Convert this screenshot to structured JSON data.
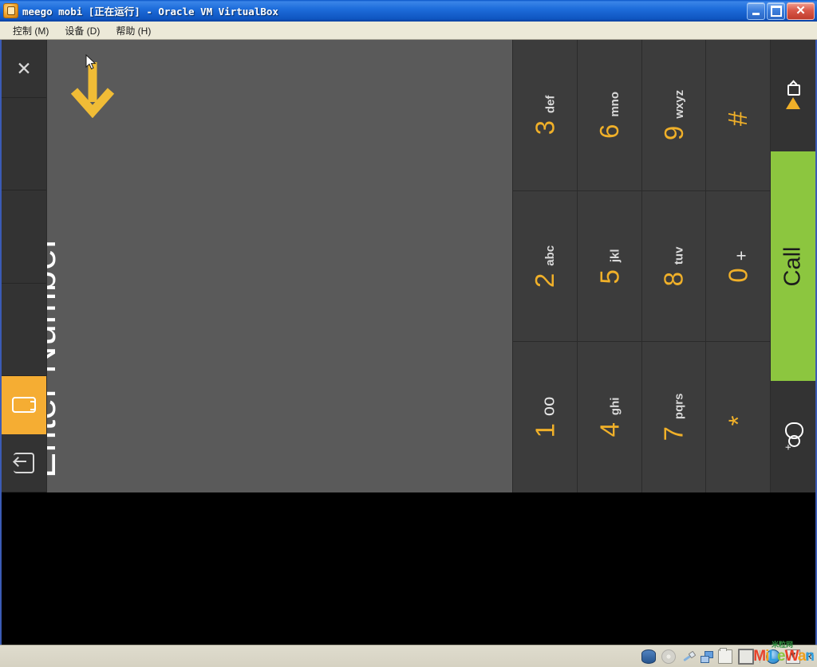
{
  "window": {
    "title": "meego mobi [正在运行] - Oracle VM VirtualBox",
    "app_icon": "virtualbox-icon",
    "buttons": {
      "minimize": "minimize-icon",
      "maximize": "maximize-icon",
      "close": "close-icon"
    }
  },
  "menubar": {
    "items": [
      {
        "label": "控制 (M)",
        "name": "menu-control"
      },
      {
        "label": "设备 (D)",
        "name": "menu-devices"
      },
      {
        "label": "帮助 (H)",
        "name": "menu-help"
      }
    ]
  },
  "guest": {
    "app_bar": {
      "close_glyph": "✕",
      "items": [
        {
          "name": "appbar-close",
          "icon": "close-icon"
        },
        {
          "name": "appbar-slot-1",
          "icon": ""
        },
        {
          "name": "appbar-slot-2",
          "icon": ""
        },
        {
          "name": "appbar-slot-3",
          "icon": ""
        },
        {
          "name": "appbar-dialer",
          "icon": "dialer-icon",
          "active": true
        },
        {
          "name": "appbar-back",
          "icon": "back-icon"
        }
      ]
    },
    "number_entry": {
      "placeholder": "Enter Number",
      "value": "",
      "hint_arrow": "down-arrow-icon"
    },
    "keypad": {
      "columns": [
        {
          "keys": [
            {
              "digit": "3",
              "letters": "def"
            },
            {
              "digit": "2",
              "letters": "abc"
            },
            {
              "digit": "1",
              "letters": "oo"
            }
          ]
        },
        {
          "keys": [
            {
              "digit": "6",
              "letters": "mno"
            },
            {
              "digit": "5",
              "letters": "jkl"
            },
            {
              "digit": "4",
              "letters": "ghi"
            }
          ]
        },
        {
          "keys": [
            {
              "digit": "9",
              "letters": "wxyz"
            },
            {
              "digit": "8",
              "letters": "tuv"
            },
            {
              "digit": "7",
              "letters": "pqrs"
            }
          ]
        },
        {
          "keys": [
            {
              "digit": "#",
              "letters": ""
            },
            {
              "digit": "0",
              "letters": "+"
            },
            {
              "digit": "*",
              "letters": ""
            }
          ]
        }
      ]
    },
    "actions": {
      "video_call": {
        "label": "",
        "icon": "video-call-icon"
      },
      "call": {
        "label": "Call",
        "color": "#8cc63f"
      },
      "add_contact": {
        "label": "",
        "icon": "add-contact-icon"
      }
    }
  },
  "statusbar": {
    "icons": [
      "hard-disk-icon",
      "cd-icon",
      "usb-icon",
      "network-icon",
      "shared-folder-icon",
      "display-icon",
      "globe-icon",
      "host-key-icon"
    ],
    "host_key_text": "Ri",
    "watermark": {
      "top_text": "米粒网",
      "letters": [
        "M",
        "i",
        "L",
        "e",
        "W",
        "a",
        "n"
      ]
    }
  },
  "colors": {
    "accent_orange": "#f0b029",
    "call_green": "#8cc63f",
    "appbar_active": "#f5ad33",
    "guest_bg": "#5a5a5a",
    "keypad_bg": "#3c3c3c",
    "titlebar_blue": "#1e6ddb"
  }
}
